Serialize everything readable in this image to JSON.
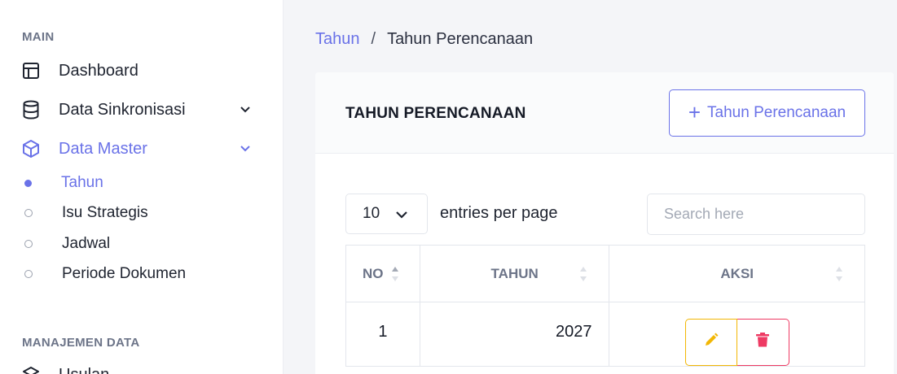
{
  "sidebar": {
    "section_main": "MAIN",
    "section_manajemen": "MANAJEMEN DATA",
    "items": [
      {
        "label": "Dashboard",
        "icon": "layout-icon"
      },
      {
        "label": "Data Sinkronisasi",
        "icon": "database-icon"
      },
      {
        "label": "Data Master",
        "icon": "cube-icon",
        "active": true
      },
      {
        "label": "Usulan",
        "icon": "layers-icon"
      }
    ],
    "subitems": [
      {
        "label": "Tahun",
        "active": true
      },
      {
        "label": "Isu Strategis"
      },
      {
        "label": "Jadwal"
      },
      {
        "label": "Periode Dokumen"
      }
    ]
  },
  "breadcrumb": {
    "parent": "Tahun",
    "separator": "/",
    "current": "Tahun Perencanaan"
  },
  "card": {
    "title": "TAHUN PERENCANAAN",
    "add_button_plus": "+",
    "add_button_label": "Tahun Perencanaan"
  },
  "table_controls": {
    "per_page_value": "10",
    "entries_label": "entries per page",
    "search_placeholder": "Search here"
  },
  "table": {
    "headers": [
      "NO",
      "TAHUN",
      "AKSI"
    ],
    "rows": [
      {
        "no": "1",
        "tahun": "2027"
      }
    ]
  },
  "colors": {
    "accent": "#6a72e8",
    "edit": "#f2b705",
    "delete": "#ee3a63",
    "muted_text": "#6c7488"
  }
}
